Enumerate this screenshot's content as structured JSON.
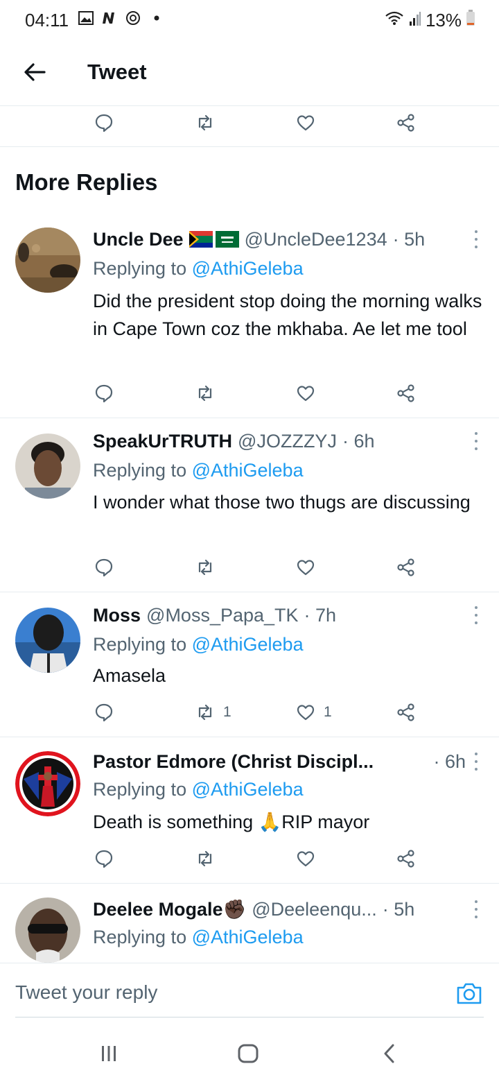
{
  "status_bar": {
    "time": "04:11",
    "battery": "13%",
    "left_icons": [
      "gallery-icon",
      "n-app-icon",
      "vpn-icon",
      "dot-icon"
    ],
    "right_icons": [
      "wifi-icon",
      "signal-icon",
      "battery-icon"
    ]
  },
  "header": {
    "title": "Tweet"
  },
  "section_title": "More Replies",
  "tweets": [
    {
      "name": "Uncle Dee",
      "emoji_flags": [
        "south-africa-flag",
        "saudi-flag"
      ],
      "handle": "@UncleDee1234",
      "time": "· 5h",
      "replying_prefix": "Replying to ",
      "replying_to": "@AthiGeleba",
      "text": "Did the president stop doing the morning walks  in Cape Town coz the mkhaba. Ae let me tool",
      "retweets": "",
      "likes": ""
    },
    {
      "name": "SpeakUrTRUTH",
      "handle": "@JOZZZYJ",
      "time": "· 6h",
      "replying_prefix": "Replying to ",
      "replying_to": "@AthiGeleba",
      "text": "I wonder what those two thugs are discussing",
      "retweets": "",
      "likes": ""
    },
    {
      "name": "Moss",
      "handle": "@Moss_Papa_TK",
      "time": "· 7h",
      "replying_prefix": "Replying to ",
      "replying_to": "@AthiGeleba",
      "text": "Amasela",
      "retweets": "1",
      "likes": "1"
    },
    {
      "name": "Pastor Edmore (Christ Discipl...",
      "handle": "",
      "time": "· 6h",
      "replying_prefix": "Replying to ",
      "replying_to": "@AthiGeleba",
      "text_before_emoji": "Death is something ",
      "emoji": "🙏",
      "text_after_emoji": "RIP mayor",
      "retweets": "",
      "likes": ""
    },
    {
      "name": "Deelee Mogale",
      "name_emoji": "✊🏿",
      "handle": "@Deeleenqu...",
      "time": "· 5h",
      "replying_prefix": "Replying to ",
      "replying_to": "@AthiGeleba"
    }
  ],
  "reply_bar": {
    "placeholder": "Tweet your reply"
  },
  "nav_bar": {
    "buttons": [
      "recent-apps-icon",
      "home-icon",
      "back-icon"
    ]
  },
  "colors": {
    "accent": "#1d9bf0",
    "text": "#0f1419",
    "muted": "#536471",
    "divider": "#e6ecf0"
  }
}
